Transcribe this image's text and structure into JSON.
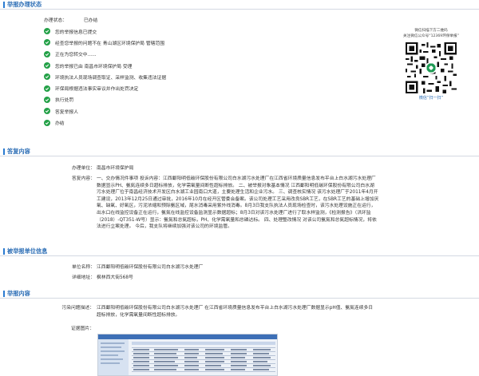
{
  "section1": {
    "title": "举报办理状态"
  },
  "status": {
    "label": "办理状态：",
    "value": "已办结"
  },
  "steps": [
    "您的举报信息已提交",
    "经查您举报的问题不在 青山湖区环境保护局 管辖范围",
    "正在为您转交中......",
    "您的举报已由 南昌市环境保护局 受理",
    "环境执法人员现场调查取证、采样监测、收集违法证据",
    "环保局根据违法事实审议并作出处罚决定",
    "执行处罚",
    "答复举报人",
    "办结"
  ],
  "qr": {
    "caption_line1": "微信扫描下方二维码",
    "caption_line2": "关注微信公众号“12369环保举报”",
    "bottom": "微信“扫一扫”"
  },
  "section2": {
    "title": "答复内容"
  },
  "reply": {
    "unit_label": "办理单位：",
    "unit_value": "南昌市环境保护局",
    "content_label": "答复内容：",
    "content_lines": [
      "一、交办情况件事项 投诉内容：江西鄱阳明低碳环保股份有限公司白水湖污水处理厂在江西省环境质量信息发布平台上白水湖污水处理厂",
      "数据显示PH、氨氮连续多日超标排放，化学需氧量间断性超标排放。 二、被举报对象基本情况 江西鄱阳明低碳环保股份有限公司白水湖",
      "污水处理厂位于南昌经济技术开发区白水湖工业园南口大道，主要处理生活和企业污水。 三、调查核实情况 该污水处理厂于2011年4月开",
      "工建设，2013年12月25日通过审批，2016年10月在经开区管委会备案。该公司处理工艺采用改良SBR工艺，在SBR工艺的基础上增加厌",
      "氧、缺氧、好氧区，污泥浓缩和预除氨区域，尾水消毒采用紫外线消毒。8月3日我支队执法人员现场检查时，该污水处理设施正在运行，",
      "出水口在线监控设备正在运行，氨氮在线监控设备监测显示数据超标；8月3日对该污水处理厂进行了取水样监测，《检测报告》（洪环监",
      "（2018）-QT351-W号）显示：氨氮和总氮超标，PH、化学需氧量和总磷达标。 四、处理整改情况 对该公司氨氮和总氮超标情况，将依",
      "法进行立案处理。 今后，我支队将继续加强对该公司的环境监管。"
    ]
  },
  "section3": {
    "title": "被举报单位信息"
  },
  "unit": {
    "name_label": "单位名称：",
    "name_value": "江西鄱阳明低碳环保股份有限公司白水湖污水处理厂",
    "addr_label": "详细地址：",
    "addr_value": "枫林西大街568号"
  },
  "section4": {
    "title": "举报内容"
  },
  "report": {
    "problem_label": "污染问题描述：",
    "problem_lines": [
      "江西鄱阳明低碳环保股份有限公司白水湖污水处理厂 在江西省环境质量信息发布平台上白水湖污水处理厂数据显示pH值、氨氮连续多日",
      "超标排放，化学需氧量间断性超标排放。"
    ],
    "evidence_label": "证据图片："
  },
  "colors": {
    "accent": "#2b6db5",
    "check": "#24a148"
  }
}
